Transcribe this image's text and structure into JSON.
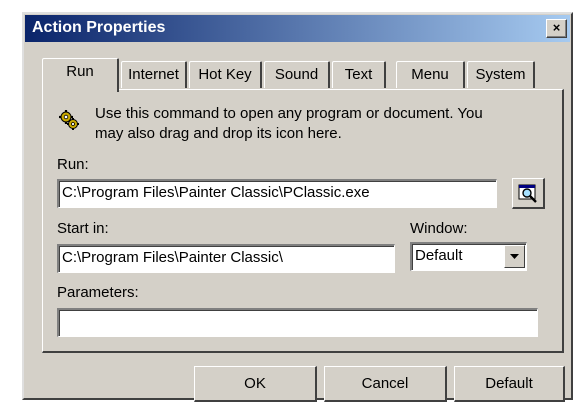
{
  "window": {
    "title": "Action Properties",
    "close_glyph": "×"
  },
  "tabs": [
    {
      "label": "Run",
      "active": true
    },
    {
      "label": "Internet",
      "active": false
    },
    {
      "label": "Hot Key",
      "active": false
    },
    {
      "label": "Sound",
      "active": false
    },
    {
      "label": "Text",
      "active": false
    },
    {
      "label": "Menu",
      "active": false
    },
    {
      "label": "System",
      "active": false
    }
  ],
  "run_tab": {
    "info_icon": "gears-icon",
    "description_line1": "Use this command to open any program or document. You",
    "description_line2": "may also drag and drop its icon here.",
    "run_label": "Run:",
    "run_value": "C:\\Program Files\\Painter Classic\\PClassic.exe",
    "browse_icon": "magnifier-browse-icon",
    "start_in_label": "Start in:",
    "start_in_value": "C:\\Program Files\\Painter Classic\\",
    "window_label": "Window:",
    "window_value": "Default",
    "parameters_label": "Parameters:",
    "parameters_value": ""
  },
  "buttons": {
    "ok": "OK",
    "cancel": "Cancel",
    "default": "Default"
  }
}
